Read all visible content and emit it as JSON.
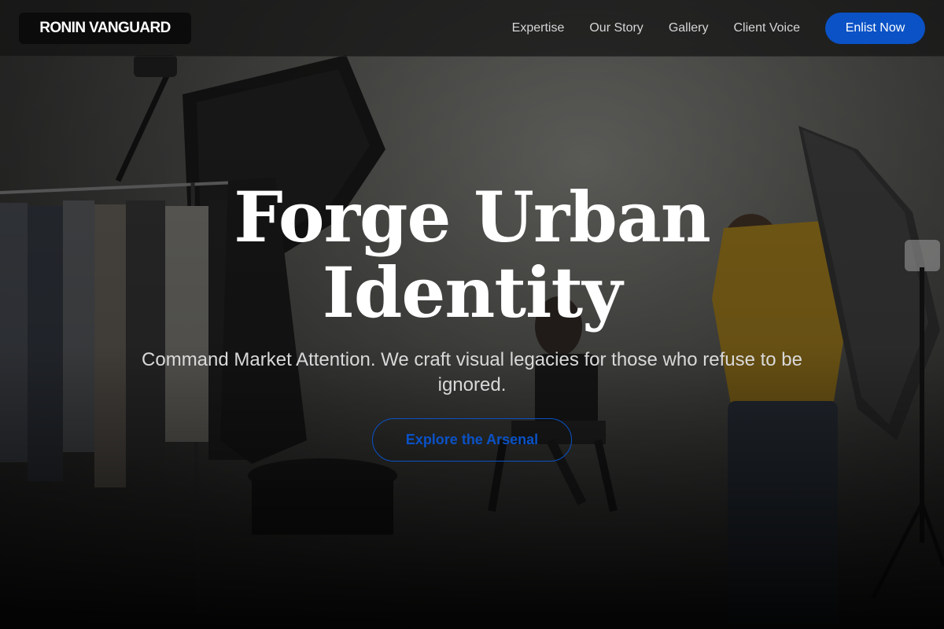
{
  "brand": {
    "name": "RONIN VANGUARD"
  },
  "nav": {
    "items": [
      {
        "label": "Expertise"
      },
      {
        "label": "Our Story"
      },
      {
        "label": "Gallery"
      },
      {
        "label": "Client Voice"
      }
    ],
    "cta_label": "Enlist Now"
  },
  "hero": {
    "title_line1": "Forge Urban",
    "title_line2": "Identity",
    "subtitle": "Command Market Attention. We craft visual legacies for those who refuse to be ignored.",
    "cta_label": "Explore the Arsenal",
    "background_image": "photo-studio-shoot"
  },
  "colors": {
    "accent": "#0a52c6",
    "header_bg": "#141414",
    "text_primary": "#ffffff",
    "text_secondary": "#d9d9d9"
  }
}
